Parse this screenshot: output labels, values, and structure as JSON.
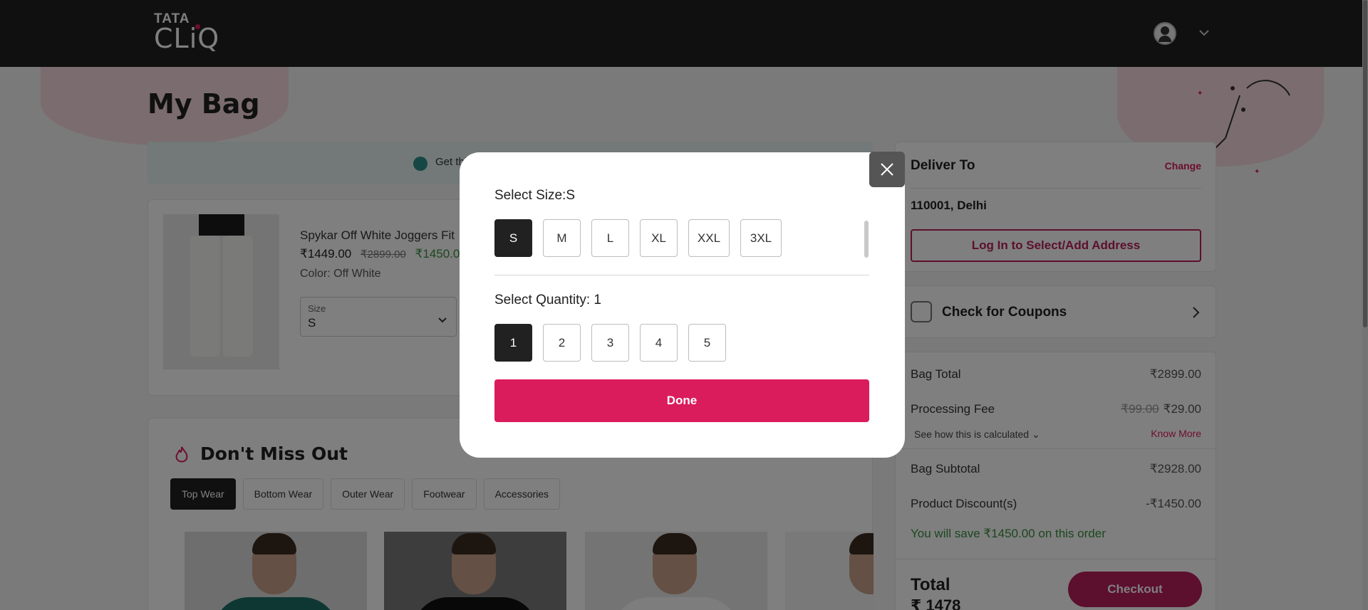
{
  "header": {
    "logo_top": "TATA",
    "logo_bottom": "CLiQ"
  },
  "page": {
    "title": "My Bag",
    "promo_text": "Get thi"
  },
  "bag_item": {
    "name": "Spykar Off White Joggers Fit",
    "price": "₹1449.00",
    "mrp": "₹2899.00",
    "sale_price": "₹1450.0",
    "color": "Color: Off White",
    "size_label": "Size",
    "size_value": "S"
  },
  "dont_miss_out": {
    "title": "Don't Miss Out",
    "tabs": [
      "Top Wear",
      "Bottom Wear",
      "Outer Wear",
      "Footwear",
      "Accessories"
    ],
    "active_tab": "Top Wear"
  },
  "deliver": {
    "title": "Deliver To",
    "change": "Change",
    "pincode": "110001, Delhi",
    "login_button": "Log In to Select/Add Address"
  },
  "coupons": {
    "title": "Check for Coupons"
  },
  "summary": {
    "bag_total_label": "Bag Total",
    "bag_total": "₹2899.00",
    "processing_fee_label": "Processing Fee",
    "processing_fee_old": "₹99.00",
    "processing_fee": "₹29.00",
    "see_how": "See how this is calculated",
    "know_more": "Know More",
    "subtotal_label": "Bag Subtotal",
    "subtotal": "₹2928.00",
    "discount_label": "Product Discount(s)",
    "discount": "-₹1450.00",
    "savings": "You will save ₹1450.00 on this order",
    "total_label": "Total",
    "total_value": "₹ 1478",
    "checkout": "Checkout"
  },
  "modal": {
    "size_label": "Select Size:S",
    "sizes": [
      "S",
      "M",
      "L",
      "XL",
      "XXL",
      "3XL"
    ],
    "selected_size": "S",
    "quantity_label": "Select Quantity: 1",
    "quantities": [
      "1",
      "2",
      "3",
      "4",
      "5"
    ],
    "selected_quantity": "1",
    "done": "Done"
  },
  "colors": {
    "brand_pink": "#da1c5c",
    "dark": "#212121",
    "savings_green": "#388e3c"
  }
}
